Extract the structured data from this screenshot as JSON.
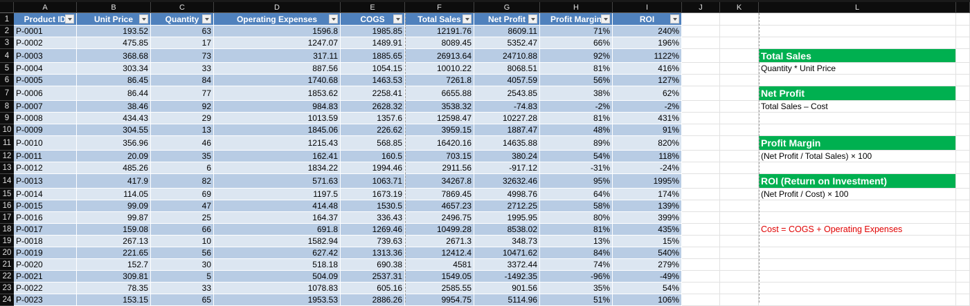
{
  "columns": [
    "A",
    "B",
    "C",
    "D",
    "E",
    "F",
    "G",
    "H",
    "I",
    "J",
    "K",
    "L"
  ],
  "headers": [
    "Product ID",
    "Unit Price",
    "Quantity",
    "Operating Expenses",
    "COGS",
    "Total Sales",
    "Net Profit",
    "Profit Margin",
    "ROI"
  ],
  "rows": [
    [
      "P-0001",
      "193.52",
      "63",
      "1596.8",
      "1985.85",
      "12191.76",
      "8609.11",
      "71%",
      "240%"
    ],
    [
      "P-0002",
      "475.85",
      "17",
      "1247.07",
      "1489.91",
      "8089.45",
      "5352.47",
      "66%",
      "196%"
    ],
    [
      "P-0003",
      "368.68",
      "73",
      "317.11",
      "1885.65",
      "26913.64",
      "24710.88",
      "92%",
      "1122%"
    ],
    [
      "P-0004",
      "303.34",
      "33",
      "887.56",
      "1054.15",
      "10010.22",
      "8068.51",
      "81%",
      "416%"
    ],
    [
      "P-0005",
      "86.45",
      "84",
      "1740.68",
      "1463.53",
      "7261.8",
      "4057.59",
      "56%",
      "127%"
    ],
    [
      "P-0006",
      "86.44",
      "77",
      "1853.62",
      "2258.41",
      "6655.88",
      "2543.85",
      "38%",
      "62%"
    ],
    [
      "P-0007",
      "38.46",
      "92",
      "984.83",
      "2628.32",
      "3538.32",
      "-74.83",
      "-2%",
      "-2%"
    ],
    [
      "P-0008",
      "434.43",
      "29",
      "1013.59",
      "1357.6",
      "12598.47",
      "10227.28",
      "81%",
      "431%"
    ],
    [
      "P-0009",
      "304.55",
      "13",
      "1845.06",
      "226.62",
      "3959.15",
      "1887.47",
      "48%",
      "91%"
    ],
    [
      "P-0010",
      "356.96",
      "46",
      "1215.43",
      "568.85",
      "16420.16",
      "14635.88",
      "89%",
      "820%"
    ],
    [
      "P-0011",
      "20.09",
      "35",
      "162.41",
      "160.5",
      "703.15",
      "380.24",
      "54%",
      "118%"
    ],
    [
      "P-0012",
      "485.26",
      "6",
      "1834.22",
      "1994.46",
      "2911.56",
      "-917.12",
      "-31%",
      "-24%"
    ],
    [
      "P-0013",
      "417.9",
      "82",
      "571.63",
      "1063.71",
      "34267.8",
      "32632.46",
      "95%",
      "1995%"
    ],
    [
      "P-0014",
      "114.05",
      "69",
      "1197.5",
      "1673.19",
      "7869.45",
      "4998.76",
      "64%",
      "174%"
    ],
    [
      "P-0015",
      "99.09",
      "47",
      "414.48",
      "1530.5",
      "4657.23",
      "2712.25",
      "58%",
      "139%"
    ],
    [
      "P-0016",
      "99.87",
      "25",
      "164.37",
      "336.43",
      "2496.75",
      "1995.95",
      "80%",
      "399%"
    ],
    [
      "P-0017",
      "159.08",
      "66",
      "691.8",
      "1269.46",
      "10499.28",
      "8538.02",
      "81%",
      "435%"
    ],
    [
      "P-0018",
      "267.13",
      "10",
      "1582.94",
      "739.63",
      "2671.3",
      "348.73",
      "13%",
      "15%"
    ],
    [
      "P-0019",
      "221.65",
      "56",
      "627.42",
      "1313.36",
      "12412.4",
      "10471.62",
      "84%",
      "540%"
    ],
    [
      "P-0020",
      "152.7",
      "30",
      "518.18",
      "690.38",
      "4581",
      "3372.44",
      "74%",
      "279%"
    ],
    [
      "P-0021",
      "309.81",
      "5",
      "504.09",
      "2537.31",
      "1549.05",
      "-1492.35",
      "-96%",
      "-49%"
    ],
    [
      "P-0022",
      "78.35",
      "33",
      "1078.83",
      "605.16",
      "2585.55",
      "901.56",
      "35%",
      "54%"
    ],
    [
      "P-0023",
      "153.15",
      "65",
      "1953.53",
      "2886.26",
      "9954.75",
      "5114.96",
      "51%",
      "106%"
    ]
  ],
  "notes": {
    "total_sales_title": "Total Sales",
    "total_sales_formula": "Quantity * Unit Price",
    "net_profit_title": "Net Profit",
    "net_profit_formula": "Total Sales –  Cost",
    "profit_margin_title": "Profit Margin",
    "profit_margin_formula": "(Net Profit / Total Sales) × 100",
    "roi_title": "ROI (Return on Investment)",
    "roi_formula": "(Net Profit / Cost) × 100",
    "cost_definition": "Cost = COGS + Operating Expenses"
  },
  "colors": {
    "header_blue": "#4f81bd",
    "band_dark": "#b8cce4",
    "band_light": "#dce6f1",
    "green": "#00b050",
    "red": "#e00000"
  }
}
